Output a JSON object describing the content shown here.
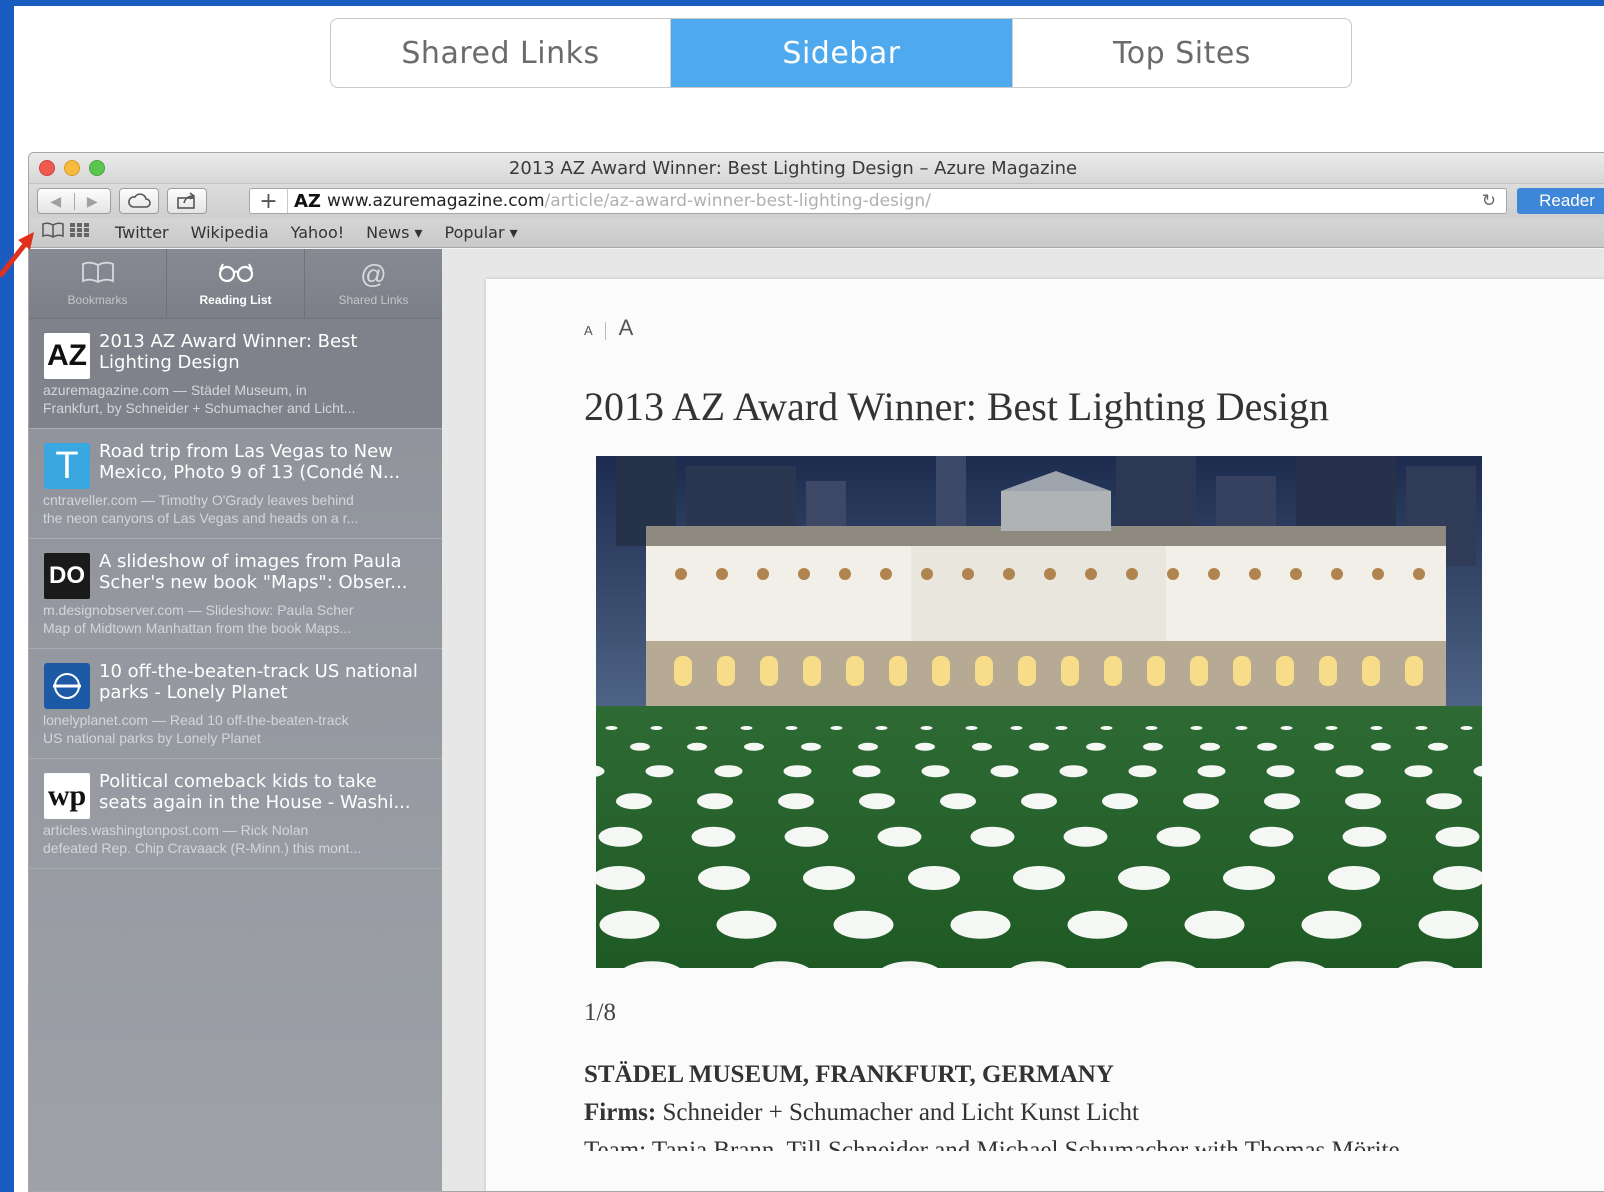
{
  "segmented": {
    "tabs": [
      {
        "label": "Shared Links",
        "active": false
      },
      {
        "label": "Sidebar",
        "active": true
      },
      {
        "label": "Top Sites",
        "active": false
      }
    ]
  },
  "window": {
    "title": "2013 AZ Award Winner: Best Lighting Design – Azure Magazine"
  },
  "toolbar": {
    "favicon": "AZ",
    "url_host": "www.azuremagazine.com",
    "url_path": "/article/az-award-winner-best-lighting-design/",
    "reader_label": "Reader"
  },
  "bookmarks_bar": {
    "items": [
      "Twitter",
      "Wikipedia",
      "Yahoo!",
      "News ▾",
      "Popular ▾"
    ]
  },
  "sidebar": {
    "tabs": [
      {
        "label": "Bookmarks",
        "icon": "book-icon"
      },
      {
        "label": "Reading List",
        "icon": "glasses-icon"
      },
      {
        "label": "Shared Links",
        "icon": "at-icon"
      }
    ],
    "items": [
      {
        "logo": "AZ",
        "title": "2013 AZ Award Winner: Best Lighting Design",
        "desc1": "azuremagazine.com — Städel Museum, in",
        "desc2": "Frankfurt, by Schneider + Schumacher and Licht..."
      },
      {
        "logo": "T",
        "title": "Road trip from Las Vegas to New Mexico, Photo 9 of 13 (Condé N...",
        "desc1": "cntraveller.com — Timothy O'Grady leaves behind",
        "desc2": "the neon canyons of Las Vegas and heads on a r..."
      },
      {
        "logo": "DO",
        "title": "A slideshow of images from Paula Scher's new book \"Maps\": Obser...",
        "desc1": "m.designobserver.com — Slideshow: Paula Scher",
        "desc2": "Map of Midtown Manhattan from the book Maps..."
      },
      {
        "logo": "lonely planet",
        "title": "10 off-the-beaten-track US national parks - Lonely Planet",
        "desc1": "lonelyplanet.com — Read 10 off-the-beaten-track",
        "desc2": "US national parks by Lonely Planet"
      },
      {
        "logo": "wp",
        "title": "Political comeback kids to take seats again in the House - Washi...",
        "desc1": "articles.washingtonpost.com — Rick Nolan",
        "desc2": "defeated Rep. Chip Cravaack (R-Minn.) this mont..."
      }
    ]
  },
  "article": {
    "font_small": "A",
    "font_big": "A",
    "title": "2013 AZ Award Winner: Best Lighting Design",
    "counter": "1/8",
    "location": "STÄDEL MUSEUM, FRANKFURT, GERMANY",
    "firms_label": "Firms:",
    "firms_value": "Schneider + Schumacher and Licht Kunst Licht",
    "team_line": "Team: Tanja Brann, Till Schneider and Michael Schumacher with Thomas Mörite"
  },
  "colors": {
    "background": "#1a5bbf",
    "segment_active": "#4fa9ee",
    "reader_button": "#3d86d8"
  }
}
